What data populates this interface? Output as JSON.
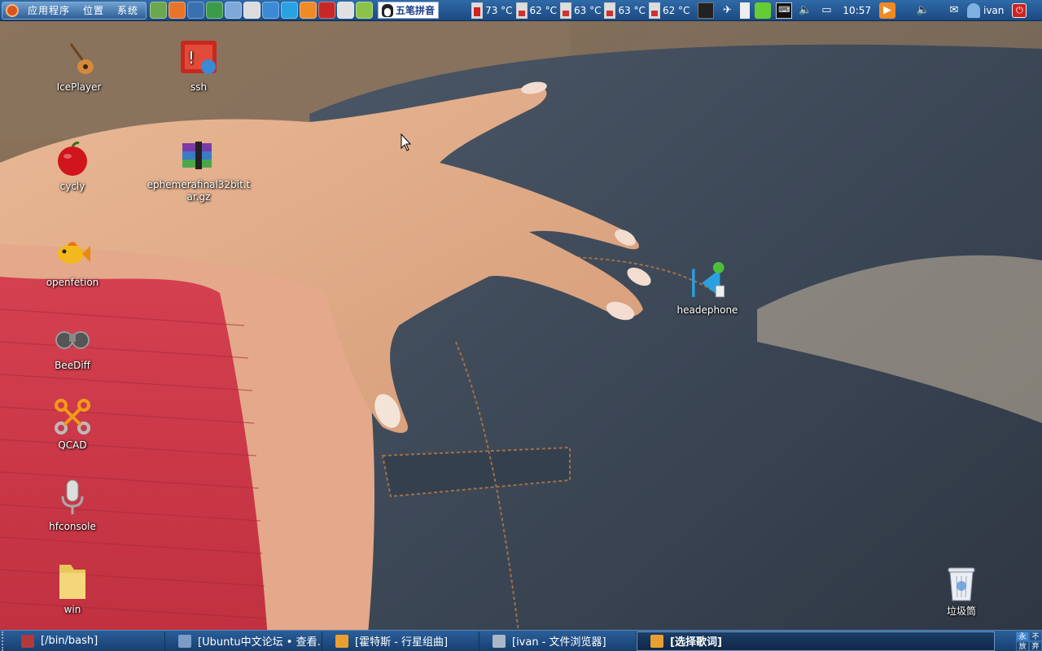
{
  "top_panel": {
    "menus": [
      "应用程序",
      "位置",
      "系统"
    ],
    "launchers": [
      {
        "icon": "image-viewer-icon",
        "color": "#6aa84f"
      },
      {
        "icon": "firefox-icon",
        "color": "#e8742a"
      },
      {
        "icon": "thunderbird-icon",
        "color": "#3a6fb0"
      },
      {
        "icon": "chrome-icon",
        "color": "#3c9b4a"
      },
      {
        "icon": "pidgin-icon",
        "color": "#7fa7d8"
      },
      {
        "icon": "screenshot-icon",
        "color": "#dcdcdc"
      },
      {
        "icon": "network-icon",
        "color": "#3a8ad6"
      },
      {
        "icon": "skype-icon",
        "color": "#2aa2e2"
      },
      {
        "icon": "media-player-icon",
        "color": "#f08a24"
      },
      {
        "icon": "flash-card-icon",
        "color": "#c62828"
      },
      {
        "icon": "keyboard-icon",
        "color": "#e0e0e0"
      },
      {
        "icon": "dictionary-icon",
        "color": "#8bc34a"
      }
    ],
    "ime_label": "五笔拼音",
    "sensors": [
      {
        "value": "73 °C",
        "level": "hot"
      },
      {
        "value": "62 °C",
        "level": "warm"
      },
      {
        "value": "63 °C",
        "level": "warm"
      },
      {
        "value": "63 °C",
        "level": "warm"
      },
      {
        "value": "62 °C",
        "level": "warm"
      }
    ],
    "clock": "10:57",
    "username": "ivan"
  },
  "desktop_icons": [
    {
      "name": "iceplayer",
      "label": "IcePlayer",
      "icon": "guitar-icon"
    },
    {
      "name": "ssh",
      "label": "ssh",
      "icon": "ssh-terminal-icon"
    },
    {
      "name": "cycly",
      "label": "cycly",
      "icon": "apple-icon"
    },
    {
      "name": "archive",
      "label": "ephemerafinal32bit.tar.gz",
      "icon": "archive-icon"
    },
    {
      "name": "openfetion",
      "label": "openfetion",
      "icon": "fish-icon"
    },
    {
      "name": "headephone",
      "label": "headephone",
      "icon": "headphone-launcher-icon"
    },
    {
      "name": "beediff",
      "label": "BeeDiff",
      "icon": "binoculars-icon"
    },
    {
      "name": "qcad",
      "label": "QCAD",
      "icon": "qcad-icon"
    },
    {
      "name": "hfconsole",
      "label": "hfconsole",
      "icon": "microphone-icon"
    },
    {
      "name": "win",
      "label": "win",
      "icon": "folder-icon"
    },
    {
      "name": "trash",
      "label": "垃圾筒",
      "icon": "trash-icon"
    }
  ],
  "taskbar": {
    "tasks": [
      {
        "label": "[/bin/bash]",
        "icon": "terminal-icon",
        "color": "#b23a3a"
      },
      {
        "label": "[Ubuntu中文论坛 • 查看...",
        "icon": "browser-icon",
        "color": "#7a9cc8"
      },
      {
        "label": "[霍特斯 - 行星组曲]",
        "icon": "media-player-icon",
        "color": "#e8a030"
      },
      {
        "label": "[ivan - 文件浏览器]",
        "icon": "file-browser-icon",
        "color": "#a9b7c6"
      },
      {
        "label": "[选择歌词]",
        "icon": "media-player-icon",
        "color": "#e8a030"
      }
    ],
    "workspaces": [
      "永",
      "不",
      "放",
      "弃"
    ]
  }
}
